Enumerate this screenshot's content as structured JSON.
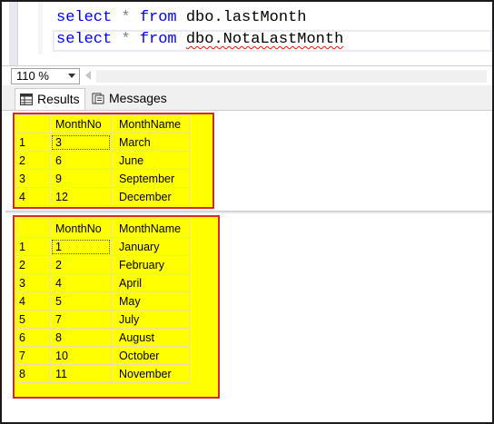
{
  "editor": {
    "lines": [
      {
        "keyword": "select",
        "star": "*",
        "from": "from",
        "object": "dbo.lastMonth"
      },
      {
        "keyword": "select",
        "star": "*",
        "from": "from",
        "object": "dbo.NotaLastMonth"
      }
    ]
  },
  "zoom": {
    "value": "110 %"
  },
  "tabs": {
    "results_label": "Results",
    "messages_label": "Messages"
  },
  "colors": {
    "keyword": "#0000ff",
    "highlight": "#ffff00",
    "highlight_border": "#d9262c",
    "error_squiggle": "#e51400"
  },
  "result_set_1": {
    "columns": [
      "MonthNo",
      "MonthName"
    ],
    "rows": [
      {
        "num": "1",
        "no": "3",
        "name": "March"
      },
      {
        "num": "2",
        "no": "6",
        "name": "June"
      },
      {
        "num": "3",
        "no": "9",
        "name": "September"
      },
      {
        "num": "4",
        "no": "12",
        "name": "December"
      }
    ]
  },
  "result_set_2": {
    "columns": [
      "MonthNo",
      "MonthName"
    ],
    "rows": [
      {
        "num": "1",
        "no": "1",
        "name": "January"
      },
      {
        "num": "2",
        "no": "2",
        "name": "February"
      },
      {
        "num": "3",
        "no": "4",
        "name": "April"
      },
      {
        "num": "4",
        "no": "5",
        "name": "May"
      },
      {
        "num": "5",
        "no": "7",
        "name": "July"
      },
      {
        "num": "6",
        "no": "8",
        "name": "August"
      },
      {
        "num": "7",
        "no": "10",
        "name": "October"
      },
      {
        "num": "8",
        "no": "11",
        "name": "November"
      }
    ]
  }
}
